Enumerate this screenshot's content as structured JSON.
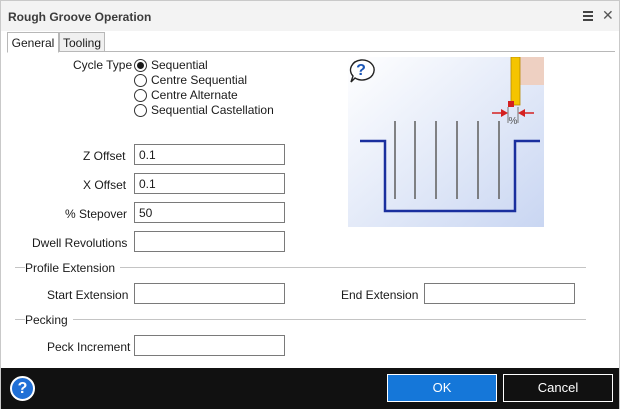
{
  "window": {
    "title": "Rough Groove Operation",
    "menu_icon": "hamburger-menu-icon",
    "close_glyph": "✕"
  },
  "tabs": [
    {
      "label": "General",
      "active": true
    },
    {
      "label": "Tooling",
      "active": false
    }
  ],
  "cycle_type": {
    "label": "Cycle Type",
    "options": [
      {
        "label": "Sequential",
        "selected": true
      },
      {
        "label": "Centre Sequential",
        "selected": false
      },
      {
        "label": "Centre Alternate",
        "selected": false
      },
      {
        "label": "Sequential Castellation",
        "selected": false
      }
    ]
  },
  "fields": {
    "z_offset": {
      "label": "Z Offset",
      "value": "0.1"
    },
    "x_offset": {
      "label": "X Offset",
      "value": "0.1"
    },
    "stepover": {
      "label": "% Stepover",
      "value": "50"
    },
    "dwell": {
      "label": "Dwell Revolutions",
      "value": ""
    }
  },
  "profile_extension": {
    "title": "Profile Extension",
    "start_label": "Start Extension",
    "start_value": "",
    "end_label": "End Extension",
    "end_value": ""
  },
  "pecking": {
    "title": "Pecking",
    "peck_label": "Peck Increment",
    "peck_value": ""
  },
  "diagram": {
    "help_glyph": "?",
    "stepover_symbol": "%"
  },
  "footer": {
    "help_glyph": "?",
    "ok_label": "OK",
    "cancel_label": "Cancel"
  },
  "colors": {
    "accent": "#1577d9",
    "footer_bg": "#111111",
    "groove_line": "#1a2f9e",
    "tool_yellow": "#f5c400",
    "arrow_red": "#d42020"
  }
}
